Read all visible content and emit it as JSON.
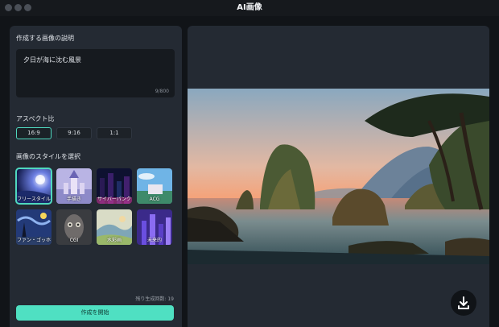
{
  "window": {
    "title": "AI画像"
  },
  "left_panel": {
    "description_label": "作成する画像の説明",
    "prompt_value": "夕日が海に沈む風景",
    "char_count": "9/800",
    "aspect_label": "アスペクト比",
    "aspect_options": [
      "16:9",
      "9:16",
      "1:1"
    ],
    "aspect_selected": "16:9",
    "style_label": "画像のスタイルを選択",
    "styles": [
      {
        "label": "フリースタイル",
        "icon": "style-freestyle-thumb"
      },
      {
        "label": "手描き",
        "icon": "style-handdrawn-thumb"
      },
      {
        "label": "サイバーパンク",
        "icon": "style-cyberpunk-thumb"
      },
      {
        "label": "ACG",
        "icon": "style-acg-thumb"
      },
      {
        "label": "ファン・ゴッホ",
        "icon": "style-vangogh-thumb"
      },
      {
        "label": "CGI",
        "icon": "style-cgi-thumb"
      },
      {
        "label": "水彩画",
        "icon": "style-watercolor-thumb"
      },
      {
        "label": "未来的",
        "icon": "style-futuristic-thumb"
      }
    ],
    "style_selected": "フリースタイル",
    "remaining_text": "残り生成回数: 19",
    "start_button": "作成を開始"
  },
  "preview": {
    "image": "sunset-sea-landscape",
    "download_icon": "download-icon"
  },
  "colors": {
    "accent": "#4fe0c2",
    "panel": "#242a33",
    "background": "#111418"
  }
}
